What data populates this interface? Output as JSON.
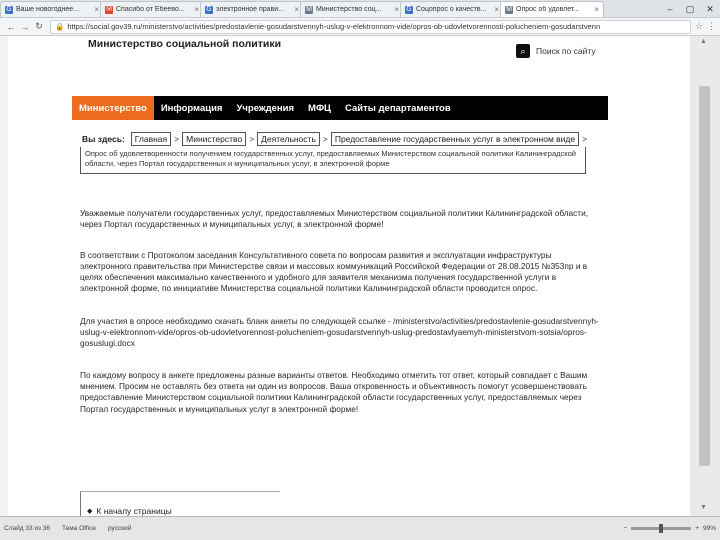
{
  "browser": {
    "tabs": [
      {
        "label": "Ваше новогоднее...",
        "color": "#3b6fc9",
        "icon": "G"
      },
      {
        "label": "Спасибо от Ебеево...",
        "color": "#e0422c",
        "icon": "✉"
      },
      {
        "label": "электронное прави...",
        "color": "#3b6fc9",
        "icon": "G"
      },
      {
        "label": "Министерство соц...",
        "color": "#6a7a8c",
        "icon": "M"
      },
      {
        "label": "Соцопрос о качеств...",
        "color": "#3b6fc9",
        "icon": "G"
      },
      {
        "label": "Опрос об удовлет...",
        "color": "#6a7a8c",
        "icon": "M"
      }
    ],
    "url": "https://social.gov39.ru/ministerstvo/activities/predostavlenie-gosudarstvennyh-uslug-v-elektronnom-vide/opros-ob-udovletvorennosti-polucheniem-gosudarstvenn"
  },
  "header": {
    "ministry_title": "Министерство социальной политики",
    "search_label": "Поиск по сайту"
  },
  "menu": {
    "items": [
      "Министерство",
      "Информация",
      "Учреждения",
      "МФЦ",
      "Сайты департаментов"
    ]
  },
  "breadcrumb": {
    "label": "Вы здесь:",
    "crumbs": [
      "Главная",
      "Министерство",
      "Деятельность",
      "Предоставление государственных услуг в электронном виде"
    ],
    "current": "Опрос об удовлетворенности получением государственных услуг, предоставляемых Министерством социальной политики Калининградской области, через Портал государственных и муниципальных услуг, в электронной форме"
  },
  "content": {
    "paragraphs": [
      "Уважаемые получатели государственных услуг, предоставляемых Министерством социальной политики Калининградской области, через Портал государственных и муниципальных услуг, в электронной форме!",
      "В соответствии с Протоколом заседания Консультативного совета по вопросам развития и эксплуатации инфраструктуры электронного правительства при Министерстве связи и массовых коммуникаций Российской Федерации от 28.08.2015 №353пр и в целях обеспечения максимально качественного и удобного для заявителя механизма получения государственной услуги в электронной форме, по инициативе Министерства социальной политики Калининградской области проводится опрос.",
      "Для участия в опросе необходимо скачать бланк анкеты по следующей ссылке - /ministerstvo/activities/predostavlenie-gosudarstvennyh-uslug-v-elektronnom-vide/opros-ob-udovletvorennost-polucheniem-gosudarstvennyh-uslug-predostavlyaemyh-ministerstvom-sotsia/opros-gosuslugi.docx",
      "По каждому вопросу в анкете предложены разные варианты ответов. Необходимо отметить тот ответ, который совпадает с Вашим мнением. Просим не оставлять без ответа ни один из вопросов. Ваша откровенность и объективность помогут усовершенствовать предоставление Министерством социальной политики Калининградской области государственных услуг, предоставляемых через Портал государственных и муниципальных услуг в электронной форме!"
    ],
    "back_to_top": "К началу страницы"
  },
  "taskbar": {
    "page_info": "Слайд 33 из 36",
    "theme": "Тема Office",
    "lang": "русский",
    "zoom": "99%"
  }
}
